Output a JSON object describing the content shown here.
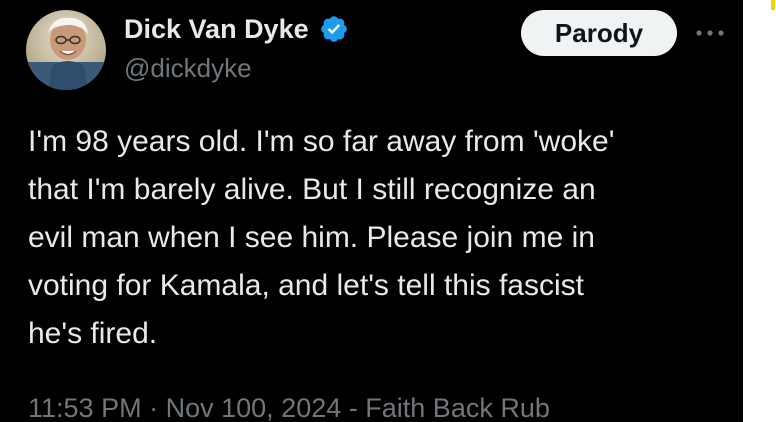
{
  "tweet": {
    "author": {
      "display_name": "Dick Van Dyke",
      "handle": "@dickdyke",
      "verified": true,
      "avatar_icon": "avatar-photo"
    },
    "label_button": "Parody",
    "more_icon": "more-horizontal-icon",
    "text": "I'm 98 years old. I'm so far away from 'woke'\nthat I'm barely alive. But I still recognize an\nevil man when I see him. Please join me in\nvoting for Kamala, and let's tell this fascist\nhe's fired.",
    "meta": {
      "time": "11:53 PM",
      "separator": "·",
      "date": "Nov 100, 2024",
      "dash": "-",
      "source": "Faith Back Rub"
    }
  },
  "colors": {
    "background": "#000000",
    "primary_text": "#e7e9ea",
    "secondary_text": "#71767b",
    "verified_blue": "#1d9bf0",
    "button_bg": "#eff3f4",
    "side_accent": "#f7d400"
  }
}
